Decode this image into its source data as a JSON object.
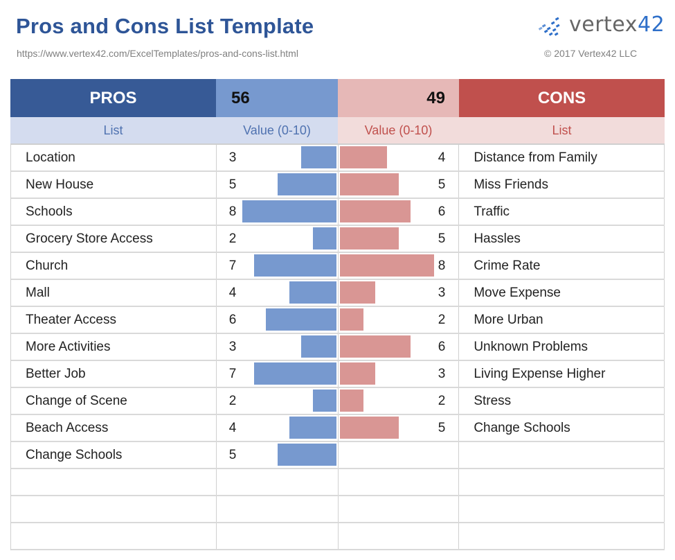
{
  "header": {
    "title": "Pros and Cons List Template",
    "url": "https://www.vertex42.com/ExcelTemplates/pros-and-cons-list.html",
    "logo_text": "vertex",
    "logo_num": "42",
    "copyright": "© 2017 Vertex42 LLC"
  },
  "table": {
    "pros_label": "PROS",
    "pros_total": "56",
    "cons_total": "49",
    "cons_label": "CONS",
    "sub_pros_list": "List",
    "sub_pros_value": "Value (0-10)",
    "sub_cons_value": "Value (0-10)",
    "sub_cons_list": "List"
  },
  "colors": {
    "pros_dark": "#375a96",
    "pros_bar": "#7799cf",
    "cons_dark": "#c0504d",
    "cons_bar": "#d99694"
  },
  "chart_data": {
    "type": "bar",
    "title": "Pros and Cons List Template",
    "xlabel": "Value (0-10)",
    "ylabel": "",
    "xlim": [
      0,
      10
    ],
    "series": [
      {
        "name": "PROS",
        "total": 56,
        "categories": [
          "Location",
          "New House",
          "Schools",
          "Grocery Store Access",
          "Church",
          "Mall",
          "Theater Access",
          "More Activities",
          "Better Job",
          "Change of Scene",
          "Beach Access",
          "Change Schools"
        ],
        "values": [
          3,
          5,
          8,
          2,
          7,
          4,
          6,
          3,
          7,
          2,
          4,
          5
        ]
      },
      {
        "name": "CONS",
        "total": 49,
        "categories": [
          "Distance from Family",
          "Miss Friends",
          "Traffic",
          "Hassles",
          "Crime Rate",
          "Move Expense",
          "More Urban",
          "Unknown Problems",
          "Living Expense Higher",
          "Stress",
          "Change Schools"
        ],
        "values": [
          4,
          5,
          6,
          5,
          8,
          3,
          2,
          6,
          3,
          2,
          5
        ]
      }
    ],
    "empty_rows": 3
  }
}
